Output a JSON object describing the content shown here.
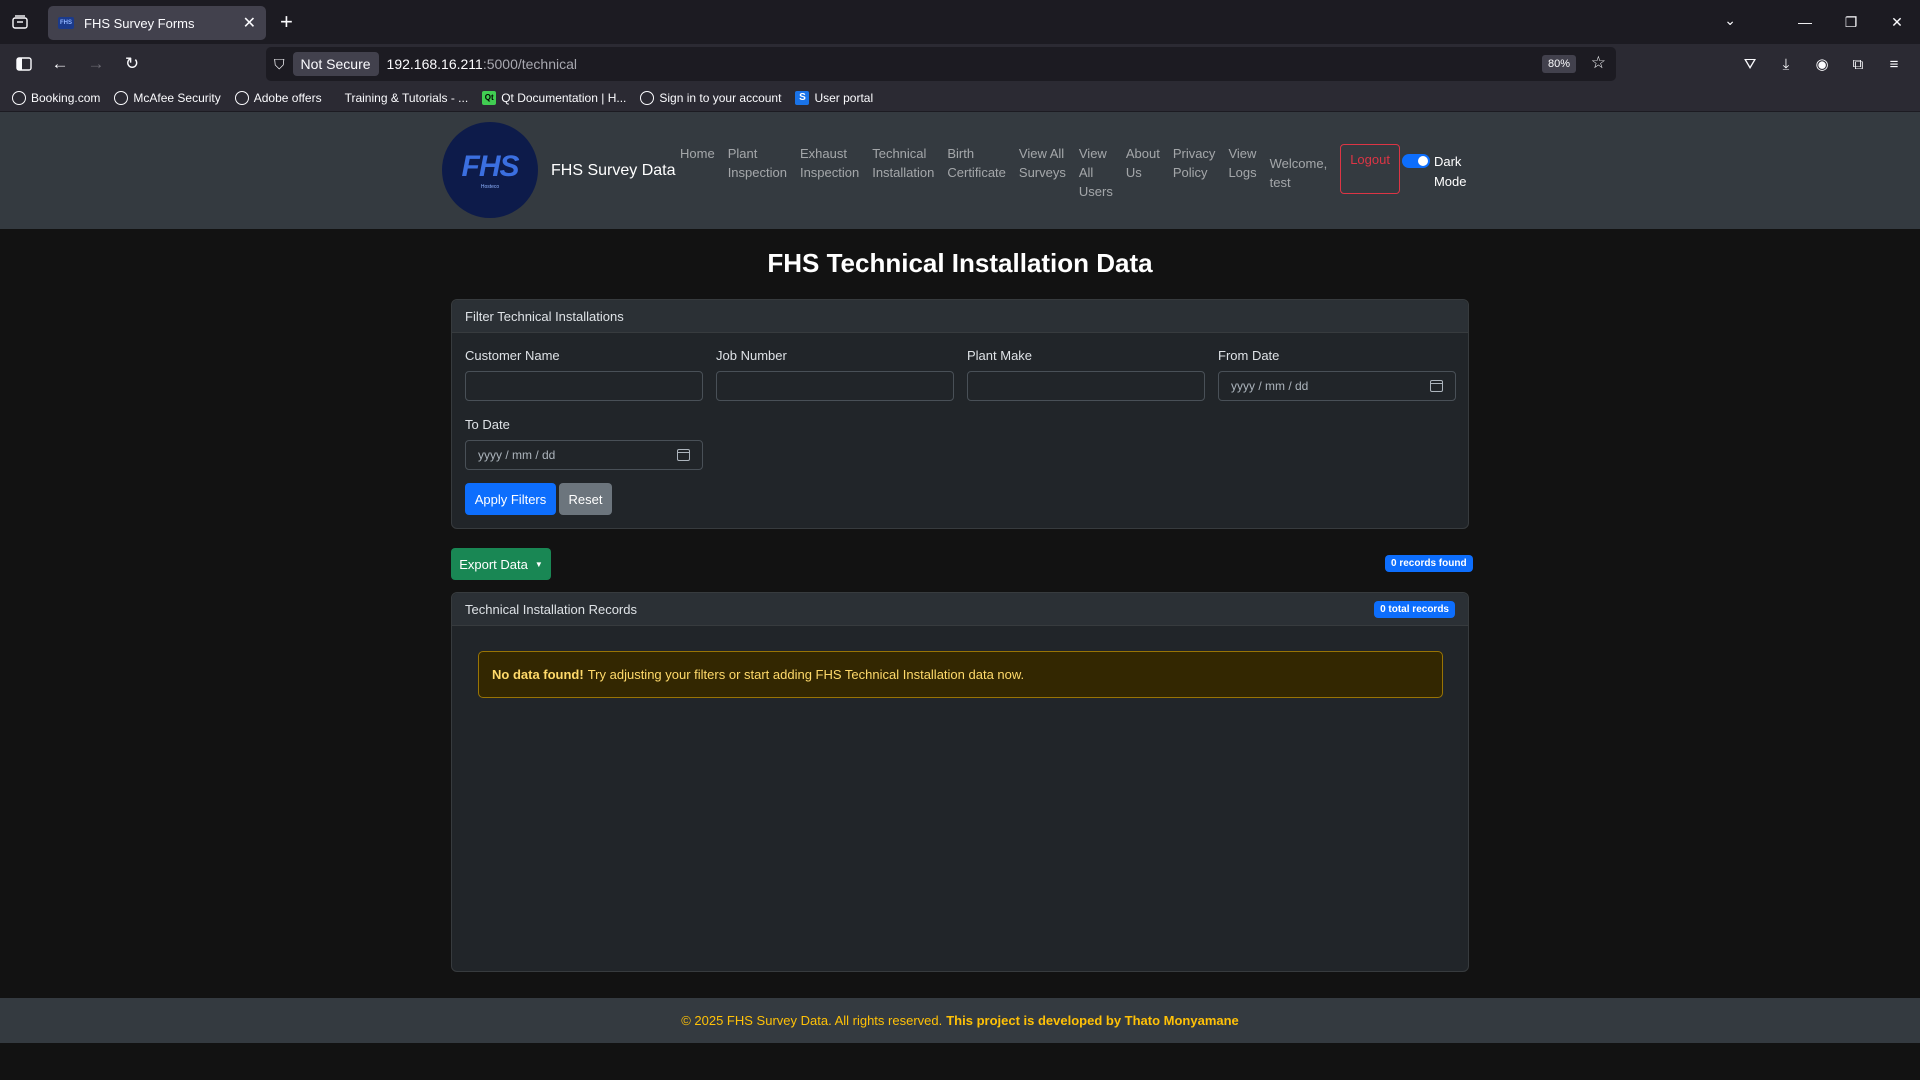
{
  "browser": {
    "tab_title": "FHS Survey Forms",
    "security_label": "Not Secure",
    "url_host": "192.168.16.211",
    "url_path": ":5000/technical",
    "zoom": "80%",
    "bookmarks": [
      "Booking.com",
      "McAfee Security",
      "Adobe offers",
      "Training & Tutorials - ...",
      "Qt Documentation | H...",
      "Sign in to your account",
      "User portal"
    ]
  },
  "nav": {
    "brand": "FHS Survey Data",
    "logo_text": "FHS",
    "logo_sub": "Hosteco",
    "items": [
      {
        "line1": "Home",
        "line2": "",
        "line3": ""
      },
      {
        "line1": "Plant",
        "line2": "Inspection",
        "line3": ""
      },
      {
        "line1": "Exhaust",
        "line2": "Inspection",
        "line3": ""
      },
      {
        "line1": "Technical",
        "line2": "Installation",
        "line3": ""
      },
      {
        "line1": "Birth",
        "line2": "Certificate",
        "line3": ""
      },
      {
        "line1": "View All",
        "line2": "Surveys",
        "line3": ""
      },
      {
        "line1": "View",
        "line2": "All",
        "line3": "Users"
      },
      {
        "line1": "About",
        "line2": "Us",
        "line3": ""
      },
      {
        "line1": "Privacy",
        "line2": "Policy",
        "line3": ""
      },
      {
        "line1": "View",
        "line2": "Logs",
        "line3": ""
      }
    ],
    "welcome_line1": "Welcome,",
    "welcome_line2": "test",
    "logout": "Logout",
    "dark_mode_line1": "Dark",
    "dark_mode_line2": "Mode"
  },
  "page": {
    "title": "FHS Technical Installation Data"
  },
  "filters": {
    "header": "Filter Technical Installations",
    "customer_name_label": "Customer Name",
    "job_number_label": "Job Number",
    "plant_make_label": "Plant Make",
    "from_date_label": "From Date",
    "to_date_label": "To Date",
    "date_placeholder": "yyyy / mm / dd",
    "apply": "Apply Filters",
    "reset": "Reset"
  },
  "export": {
    "label": "Export Data",
    "records_found": "0 records found"
  },
  "records": {
    "header": "Technical Installation Records",
    "total": "0 total records",
    "alert_strong": "No data found!",
    "alert_text": "Try adjusting your filters or start adding FHS Technical Installation data now."
  },
  "footer": {
    "copyright": "© 2025 FHS Survey Data. All rights reserved.",
    "credit": "This project is developed by Thato Monyamane"
  }
}
